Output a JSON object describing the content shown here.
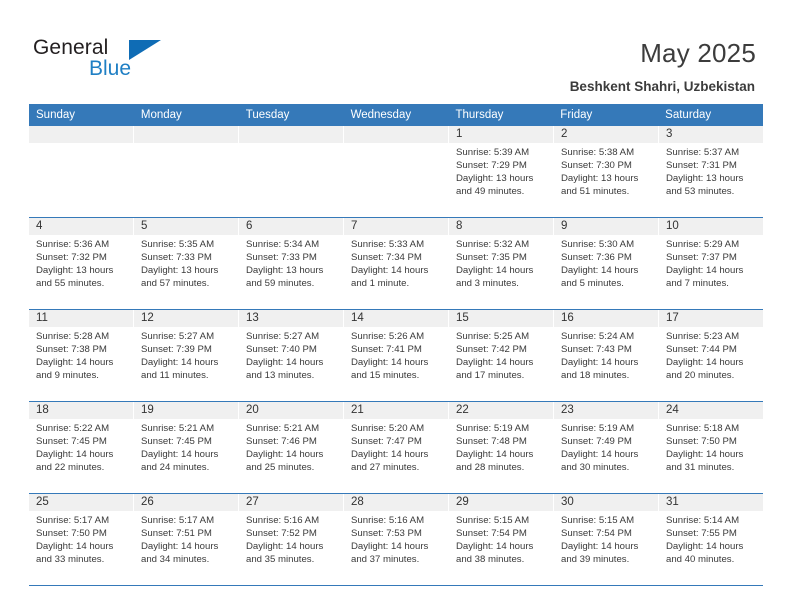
{
  "logo": {
    "word1": "General",
    "word2": "Blue",
    "triangle": "triangle-logo-mark"
  },
  "header": {
    "title": "May 2025",
    "subtitle": "Beshkent Shahri, Uzbekistan"
  },
  "calendar": {
    "day_headers": [
      "Sunday",
      "Monday",
      "Tuesday",
      "Wednesday",
      "Thursday",
      "Friday",
      "Saturday"
    ],
    "accent_color": "#3579b9",
    "daynum_band_color": "#f0f0f0",
    "weeks": [
      [
        {
          "day": "",
          "empty": true
        },
        {
          "day": "",
          "empty": true
        },
        {
          "day": "",
          "empty": true
        },
        {
          "day": "",
          "empty": true
        },
        {
          "day": "1",
          "sunrise": "Sunrise: 5:39 AM",
          "sunset": "Sunset: 7:29 PM",
          "daylight": "Daylight: 13 hours and 49 minutes."
        },
        {
          "day": "2",
          "sunrise": "Sunrise: 5:38 AM",
          "sunset": "Sunset: 7:30 PM",
          "daylight": "Daylight: 13 hours and 51 minutes."
        },
        {
          "day": "3",
          "sunrise": "Sunrise: 5:37 AM",
          "sunset": "Sunset: 7:31 PM",
          "daylight": "Daylight: 13 hours and 53 minutes."
        }
      ],
      [
        {
          "day": "4",
          "sunrise": "Sunrise: 5:36 AM",
          "sunset": "Sunset: 7:32 PM",
          "daylight": "Daylight: 13 hours and 55 minutes."
        },
        {
          "day": "5",
          "sunrise": "Sunrise: 5:35 AM",
          "sunset": "Sunset: 7:33 PM",
          "daylight": "Daylight: 13 hours and 57 minutes."
        },
        {
          "day": "6",
          "sunrise": "Sunrise: 5:34 AM",
          "sunset": "Sunset: 7:33 PM",
          "daylight": "Daylight: 13 hours and 59 minutes."
        },
        {
          "day": "7",
          "sunrise": "Sunrise: 5:33 AM",
          "sunset": "Sunset: 7:34 PM",
          "daylight": "Daylight: 14 hours and 1 minute."
        },
        {
          "day": "8",
          "sunrise": "Sunrise: 5:32 AM",
          "sunset": "Sunset: 7:35 PM",
          "daylight": "Daylight: 14 hours and 3 minutes."
        },
        {
          "day": "9",
          "sunrise": "Sunrise: 5:30 AM",
          "sunset": "Sunset: 7:36 PM",
          "daylight": "Daylight: 14 hours and 5 minutes."
        },
        {
          "day": "10",
          "sunrise": "Sunrise: 5:29 AM",
          "sunset": "Sunset: 7:37 PM",
          "daylight": "Daylight: 14 hours and 7 minutes."
        }
      ],
      [
        {
          "day": "11",
          "sunrise": "Sunrise: 5:28 AM",
          "sunset": "Sunset: 7:38 PM",
          "daylight": "Daylight: 14 hours and 9 minutes."
        },
        {
          "day": "12",
          "sunrise": "Sunrise: 5:27 AM",
          "sunset": "Sunset: 7:39 PM",
          "daylight": "Daylight: 14 hours and 11 minutes."
        },
        {
          "day": "13",
          "sunrise": "Sunrise: 5:27 AM",
          "sunset": "Sunset: 7:40 PM",
          "daylight": "Daylight: 14 hours and 13 minutes."
        },
        {
          "day": "14",
          "sunrise": "Sunrise: 5:26 AM",
          "sunset": "Sunset: 7:41 PM",
          "daylight": "Daylight: 14 hours and 15 minutes."
        },
        {
          "day": "15",
          "sunrise": "Sunrise: 5:25 AM",
          "sunset": "Sunset: 7:42 PM",
          "daylight": "Daylight: 14 hours and 17 minutes."
        },
        {
          "day": "16",
          "sunrise": "Sunrise: 5:24 AM",
          "sunset": "Sunset: 7:43 PM",
          "daylight": "Daylight: 14 hours and 18 minutes."
        },
        {
          "day": "17",
          "sunrise": "Sunrise: 5:23 AM",
          "sunset": "Sunset: 7:44 PM",
          "daylight": "Daylight: 14 hours and 20 minutes."
        }
      ],
      [
        {
          "day": "18",
          "sunrise": "Sunrise: 5:22 AM",
          "sunset": "Sunset: 7:45 PM",
          "daylight": "Daylight: 14 hours and 22 minutes."
        },
        {
          "day": "19",
          "sunrise": "Sunrise: 5:21 AM",
          "sunset": "Sunset: 7:45 PM",
          "daylight": "Daylight: 14 hours and 24 minutes."
        },
        {
          "day": "20",
          "sunrise": "Sunrise: 5:21 AM",
          "sunset": "Sunset: 7:46 PM",
          "daylight": "Daylight: 14 hours and 25 minutes."
        },
        {
          "day": "21",
          "sunrise": "Sunrise: 5:20 AM",
          "sunset": "Sunset: 7:47 PM",
          "daylight": "Daylight: 14 hours and 27 minutes."
        },
        {
          "day": "22",
          "sunrise": "Sunrise: 5:19 AM",
          "sunset": "Sunset: 7:48 PM",
          "daylight": "Daylight: 14 hours and 28 minutes."
        },
        {
          "day": "23",
          "sunrise": "Sunrise: 5:19 AM",
          "sunset": "Sunset: 7:49 PM",
          "daylight": "Daylight: 14 hours and 30 minutes."
        },
        {
          "day": "24",
          "sunrise": "Sunrise: 5:18 AM",
          "sunset": "Sunset: 7:50 PM",
          "daylight": "Daylight: 14 hours and 31 minutes."
        }
      ],
      [
        {
          "day": "25",
          "sunrise": "Sunrise: 5:17 AM",
          "sunset": "Sunset: 7:50 PM",
          "daylight": "Daylight: 14 hours and 33 minutes."
        },
        {
          "day": "26",
          "sunrise": "Sunrise: 5:17 AM",
          "sunset": "Sunset: 7:51 PM",
          "daylight": "Daylight: 14 hours and 34 minutes."
        },
        {
          "day": "27",
          "sunrise": "Sunrise: 5:16 AM",
          "sunset": "Sunset: 7:52 PM",
          "daylight": "Daylight: 14 hours and 35 minutes."
        },
        {
          "day": "28",
          "sunrise": "Sunrise: 5:16 AM",
          "sunset": "Sunset: 7:53 PM",
          "daylight": "Daylight: 14 hours and 37 minutes."
        },
        {
          "day": "29",
          "sunrise": "Sunrise: 5:15 AM",
          "sunset": "Sunset: 7:54 PM",
          "daylight": "Daylight: 14 hours and 38 minutes."
        },
        {
          "day": "30",
          "sunrise": "Sunrise: 5:15 AM",
          "sunset": "Sunset: 7:54 PM",
          "daylight": "Daylight: 14 hours and 39 minutes."
        },
        {
          "day": "31",
          "sunrise": "Sunrise: 5:14 AM",
          "sunset": "Sunset: 7:55 PM",
          "daylight": "Daylight: 14 hours and 40 minutes."
        }
      ]
    ]
  }
}
